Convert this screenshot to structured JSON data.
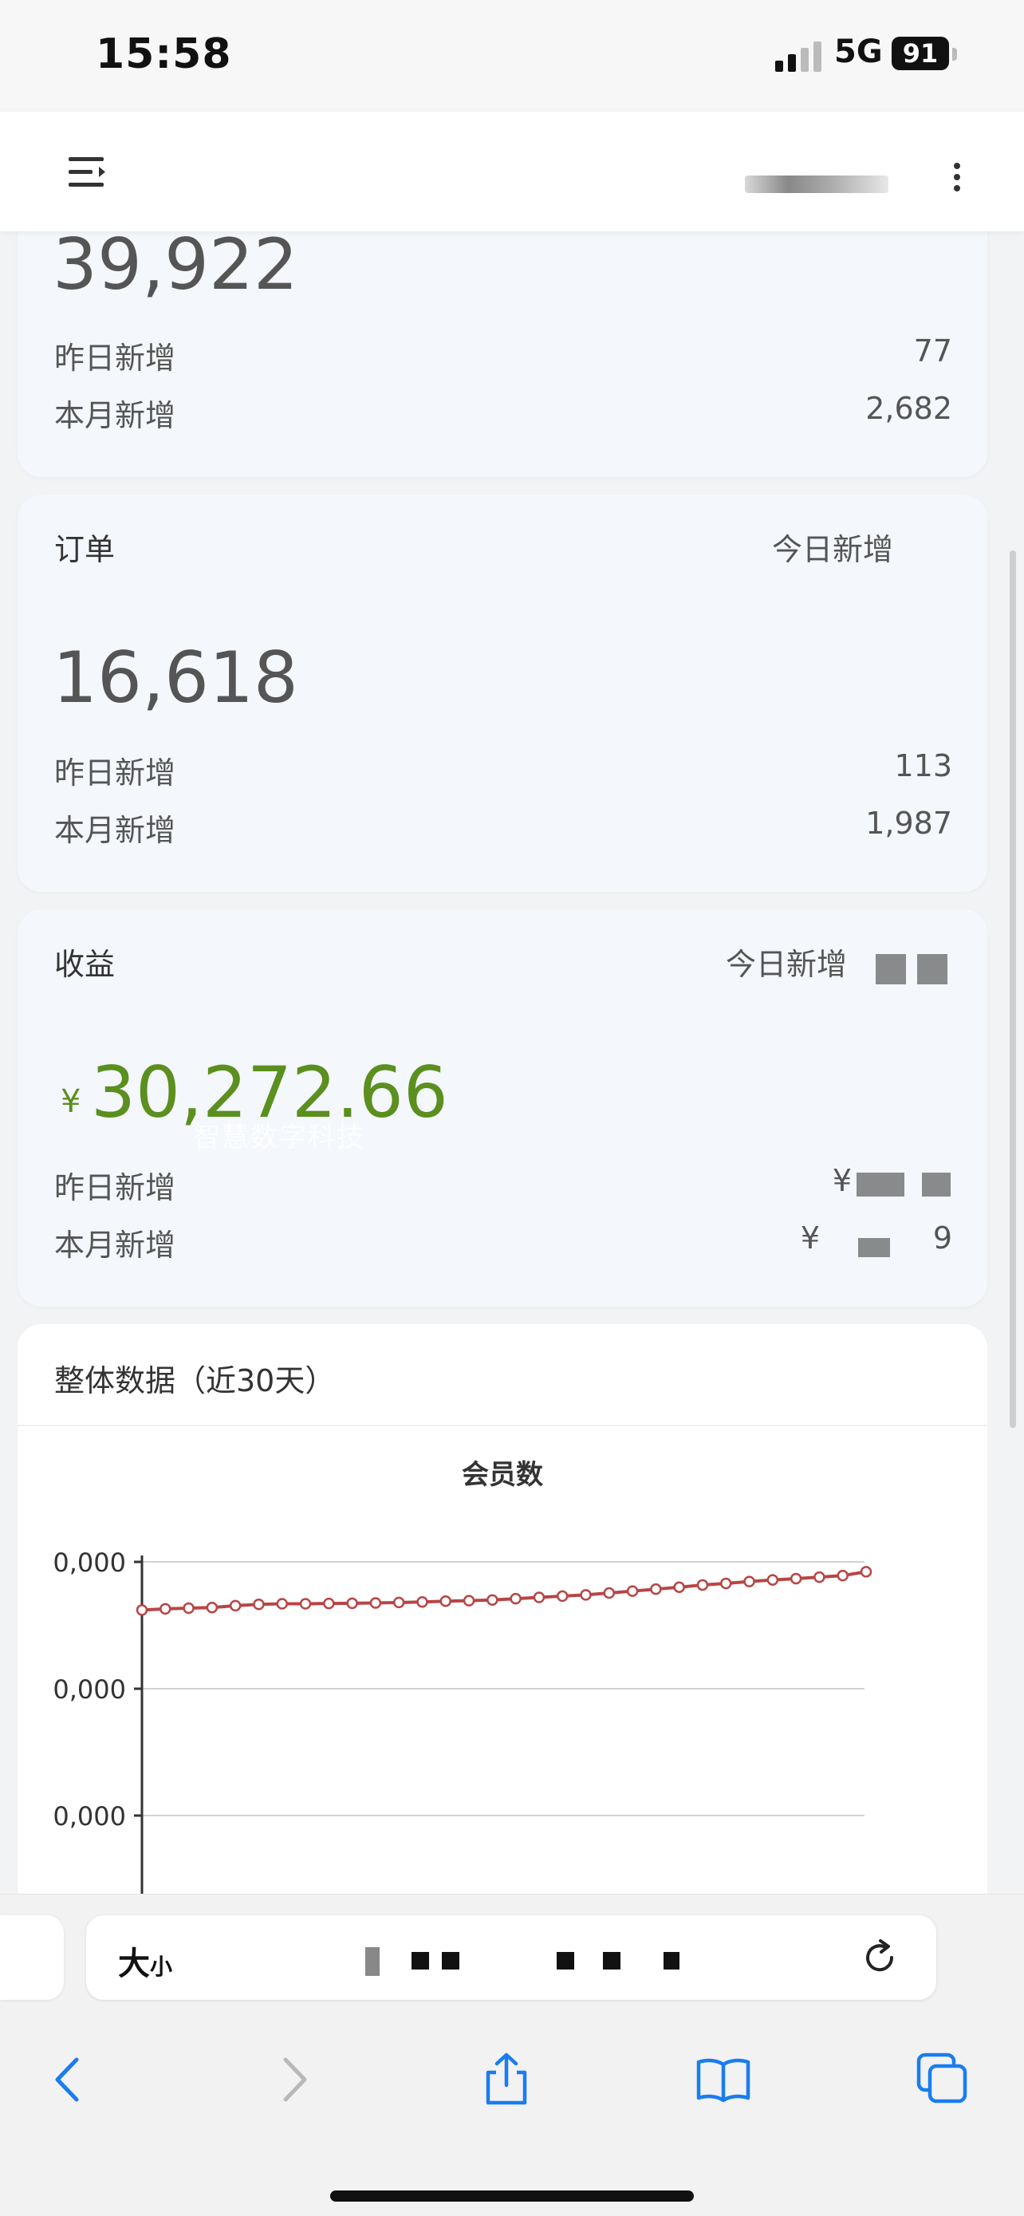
{
  "status_bar": {
    "time": "15:58",
    "network": "5G",
    "battery": "91"
  },
  "members_card": {
    "total": "39,922",
    "yesterday_label": "昨日新增",
    "yesterday_value": "77",
    "month_label": "本月新增",
    "month_value": "2,682"
  },
  "orders_card": {
    "title": "订单",
    "today_label": "今日新增",
    "total": "16,618",
    "yesterday_label": "昨日新增",
    "yesterday_value": "113",
    "month_label": "本月新增",
    "month_value": "1,987"
  },
  "revenue_card": {
    "title": "收益",
    "today_label": "今日新增",
    "currency_symbol": "¥",
    "total": "30,272.66",
    "watermark": "智慧数字科技",
    "yesterday_label": "昨日新增",
    "yesterday_value_prefix": "¥",
    "month_label": "本月新增",
    "month_value_prefix": "¥",
    "month_value_suffix": "9"
  },
  "overview": {
    "title": "整体数据（近30天）",
    "chart_title": "会员数"
  },
  "chart_data": {
    "type": "line",
    "title": "会员数",
    "y_tick_labels": [
      "0,000",
      "0,000",
      "0,000"
    ],
    "y_tick_values": [
      40000,
      39000,
      38000
    ],
    "ylim": [
      38000,
      40000
    ],
    "grid": true,
    "series": [
      {
        "color": "#b84545",
        "values": [
          39620,
          39630,
          39635,
          39640,
          39655,
          39665,
          39670,
          39670,
          39672,
          39674,
          39676,
          39680,
          39684,
          39690,
          39694,
          39700,
          39710,
          39720,
          39730,
          39740,
          39755,
          39770,
          39785,
          39800,
          39818,
          39830,
          39845,
          39858,
          39868,
          39880,
          39892,
          39922
        ]
      }
    ]
  },
  "safari": {
    "aa_big": "大",
    "aa_small": "小"
  },
  "colors": {
    "revenue_green": "#5b8f1e",
    "line_red": "#b84545"
  }
}
